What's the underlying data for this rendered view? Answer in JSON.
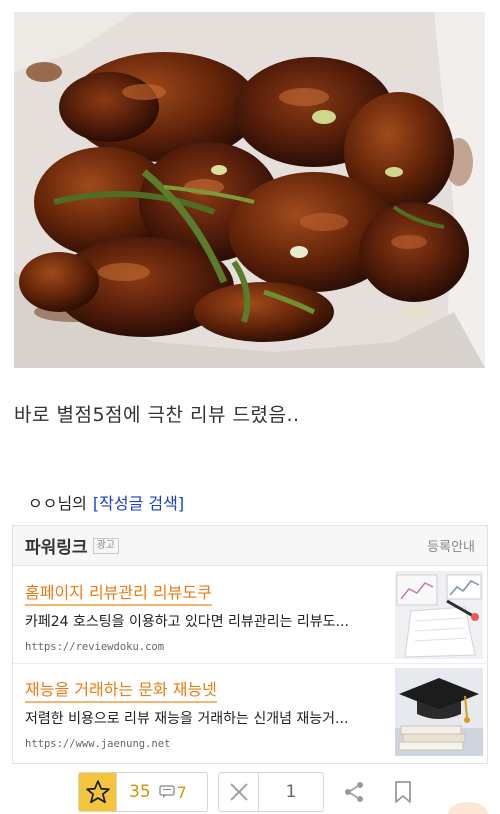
{
  "post": {
    "body_text": "바로 별점5점에 극찬 리뷰 드렸음..",
    "author_suffix": "ㅇㅇ님의",
    "search_link": "[작성글 검색]"
  },
  "powerlink": {
    "title": "파워링크",
    "ad_badge": "광고",
    "register_label": "등록안내",
    "ads": [
      {
        "title": "홈페이지 리뷰관리 리뷰도쿠",
        "description": "카페24 호스팅을 이용하고 있다면 리뷰관리는 리뷰도...",
        "url": "https://reviewdoku.com"
      },
      {
        "title": "재능을 거래하는 문화 재능넷",
        "description": "저렴한 비용으로 리뷰 재능을 거래하는 신개념 재능거...",
        "url": "https://www.jaenung.net"
      }
    ]
  },
  "actions": {
    "like_count": "35",
    "comment_count": "7",
    "vote_count": "1",
    "icons": [
      "star-icon",
      "comment-icon",
      "close-icon",
      "share-icon",
      "bookmark-icon"
    ]
  },
  "colors": {
    "ad_title": "#ee7a12",
    "ad_underline": "#f6b56c",
    "link_blue": "#1b3fc4",
    "star_bg": "#f5c43d",
    "count_color": "#d79400"
  }
}
